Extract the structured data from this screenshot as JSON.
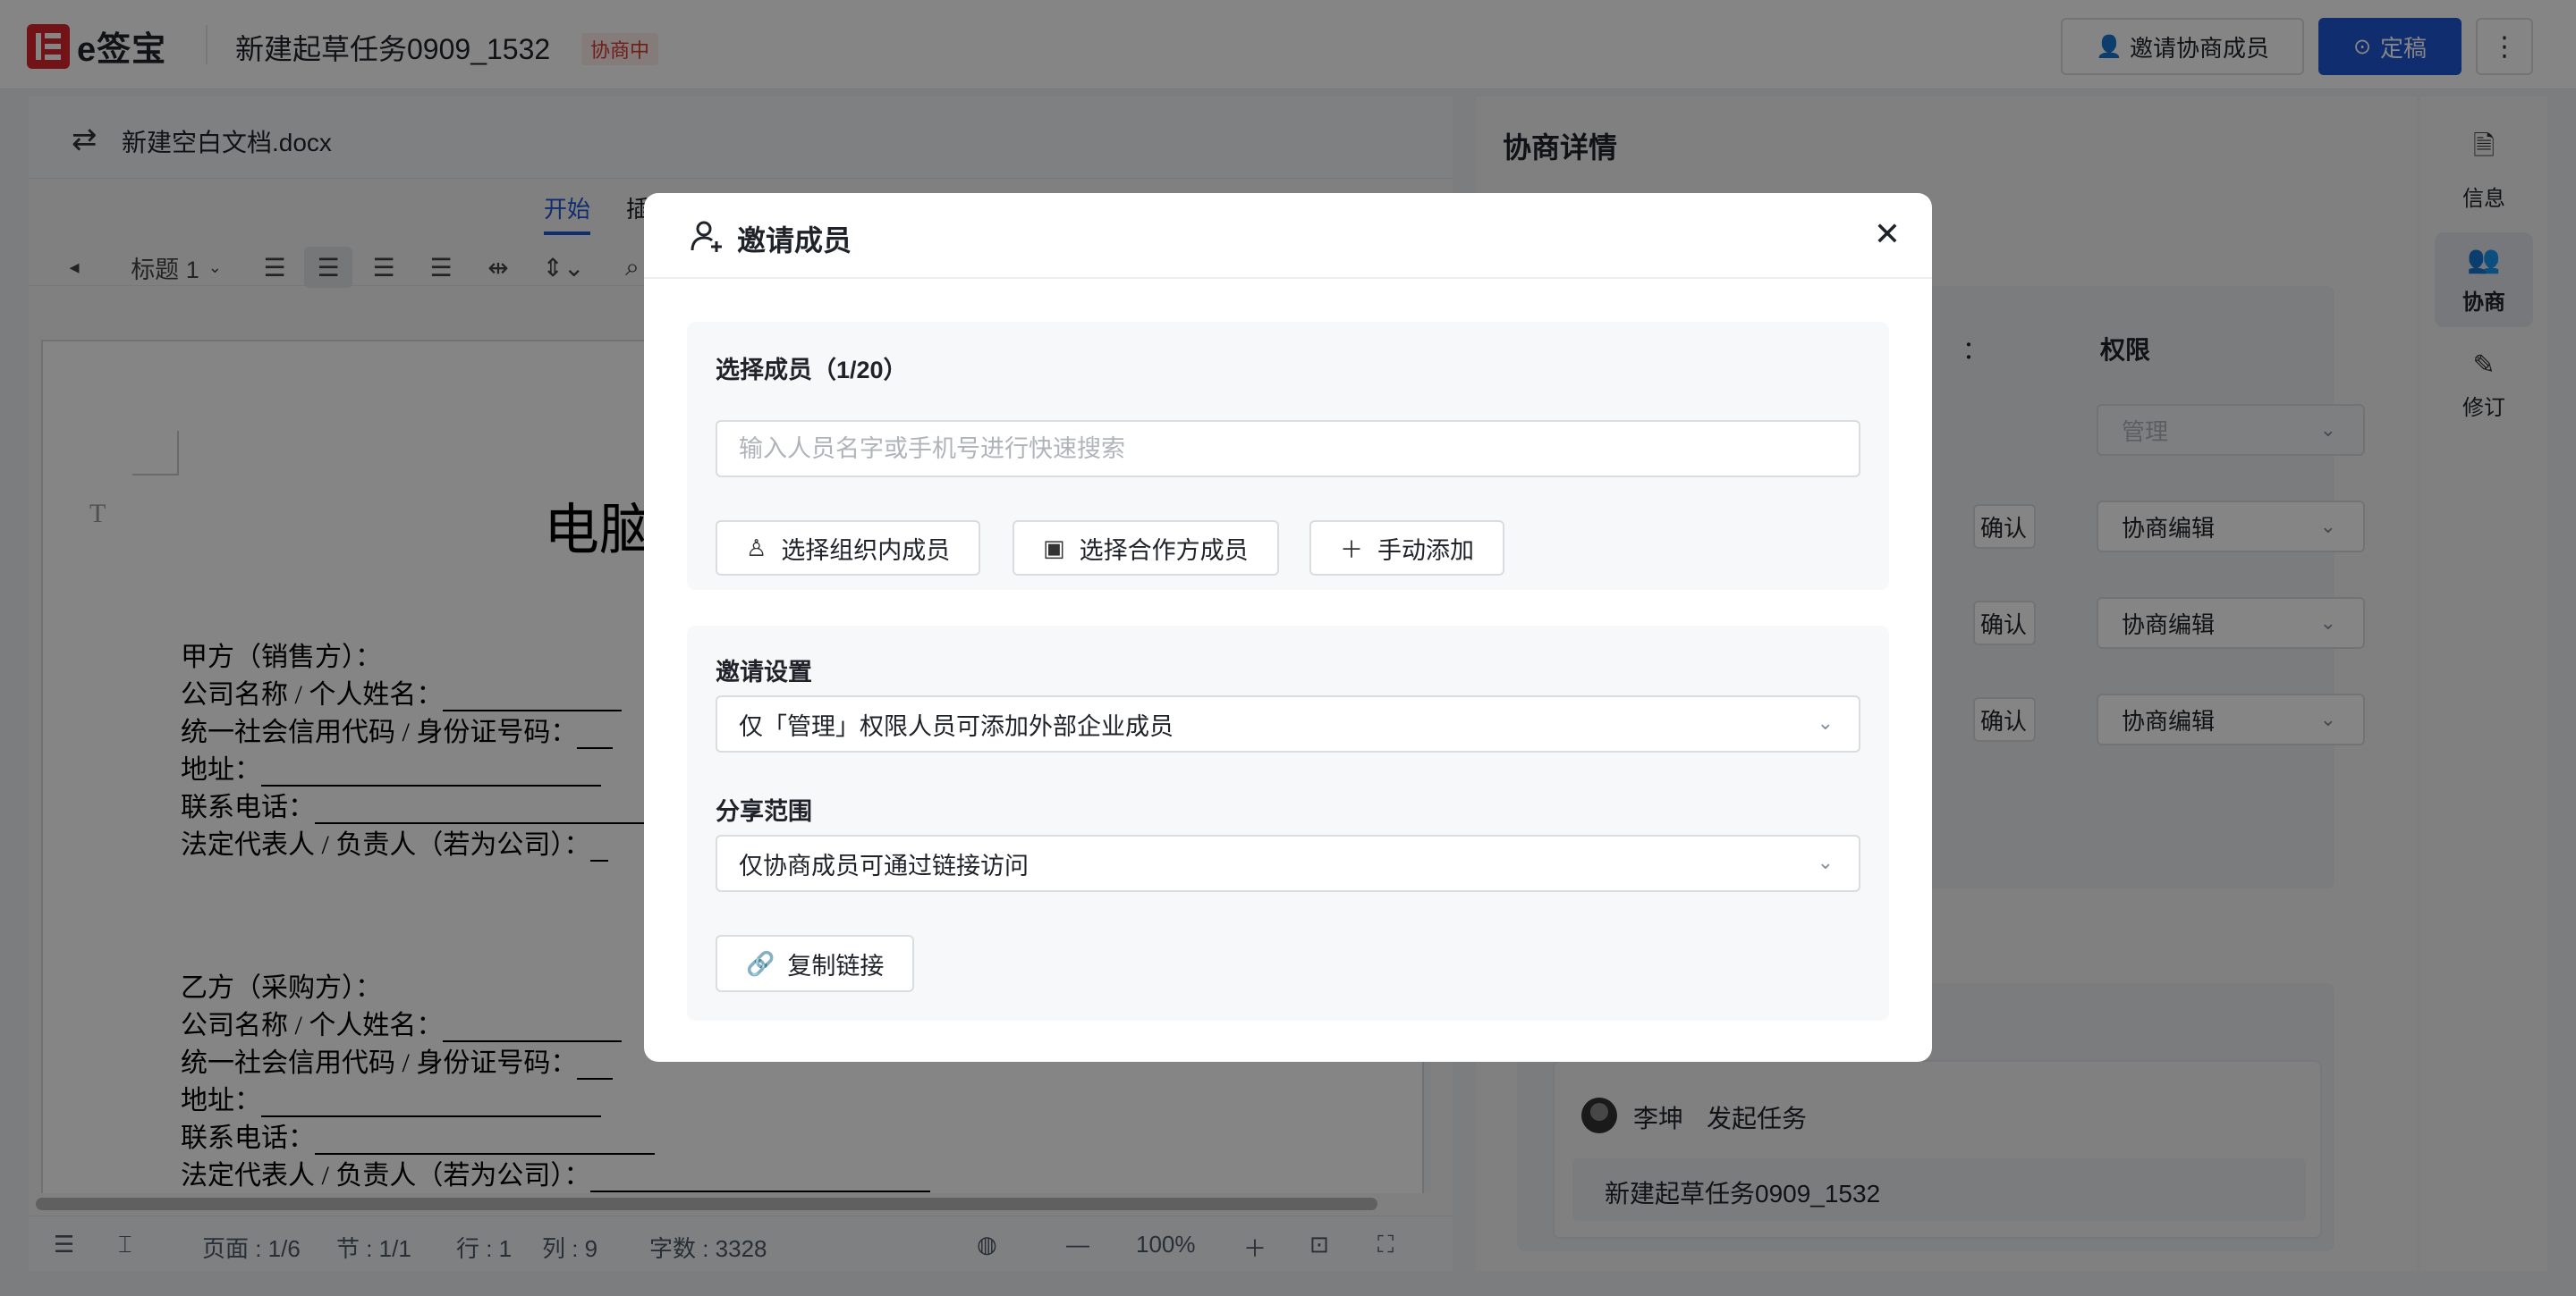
{
  "app": {
    "brand": "e签宝",
    "task_title": "新建起草任务0909_1532",
    "status": "协商中"
  },
  "toolbar": {
    "invite_label": "邀请协商成员",
    "finalize_label": "定稿",
    "more_label": "⋮"
  },
  "editor": {
    "doc_name": "新建空白文档.docx",
    "tabs": [
      "开始",
      "插"
    ],
    "format": {
      "heading_style": "标题 1"
    },
    "document": {
      "heading": "电脑",
      "lines": [
        {
          "text": "甲方（销售方）：",
          "u": 0
        },
        {
          "text": "公司名称 / 个人姓名：",
          "u": 200
        },
        {
          "text": "统一社会信用代码 / 身份证号码：",
          "u": 40
        },
        {
          "text": "地址：",
          "u": 380
        },
        {
          "text": "联系电话：",
          "u": 380
        },
        {
          "text": "法定代表人 / 负责人（若为公司）：",
          "u": 20
        },
        {
          "text": "",
          "u": 0
        },
        {
          "text": "乙方（采购方）：",
          "u": 0
        },
        {
          "text": "公司名称 / 个人姓名：",
          "u": 200
        },
        {
          "text": "统一社会信用代码 / 身份证号码：",
          "u": 40
        },
        {
          "text": "地址：",
          "u": 380
        },
        {
          "text": "联系电话：",
          "u": 380
        },
        {
          "text": "法定代表人 / 负责人（若为公司）：",
          "u": 380
        }
      ]
    },
    "statusbar": {
      "page": "页面 : 1/6",
      "section": "节 : 1/1",
      "row": "行 : 1",
      "col": "列 : 9",
      "words": "字数 : 3328",
      "zoom": "100%"
    }
  },
  "panel": {
    "title": "协商详情",
    "table": {
      "partial_header": "：",
      "perm_header": "权限",
      "rows": [
        {
          "confirm": "",
          "perm": "管理",
          "disabled": true
        },
        {
          "confirm": "确认",
          "perm": "协商编辑",
          "disabled": false
        },
        {
          "confirm": "确认",
          "perm": "协商编辑",
          "disabled": false
        },
        {
          "confirm": "确认",
          "perm": "协商编辑",
          "disabled": false
        }
      ]
    },
    "log": {
      "user": "李坤",
      "action": "发起任务",
      "detail": "新建起草任务0909_1532"
    }
  },
  "rail": {
    "items": [
      {
        "label": "信息",
        "icon": "document-icon"
      },
      {
        "label": "协商",
        "icon": "users-icon",
        "active": true
      },
      {
        "label": "修订",
        "icon": "pencil-icon"
      }
    ]
  },
  "modal": {
    "title": "邀请成员",
    "select_members": {
      "label": "选择成员（1/20）",
      "placeholder": "输入人员名字或手机号进行快速搜索",
      "buttons": {
        "org": "选择组织内成员",
        "partner": "选择合作方成员",
        "manual": "手动添加"
      }
    },
    "invite_settings": {
      "label": "邀请设置",
      "value": "仅「管理」权限人员可添加外部企业成员"
    },
    "share_scope": {
      "label": "分享范围",
      "value": "仅协商成员可通过链接访问"
    },
    "copy_link": "复制链接"
  },
  "colors": {
    "accent": "#1f56d6",
    "brand": "#d8262c",
    "status": "#d83931"
  }
}
